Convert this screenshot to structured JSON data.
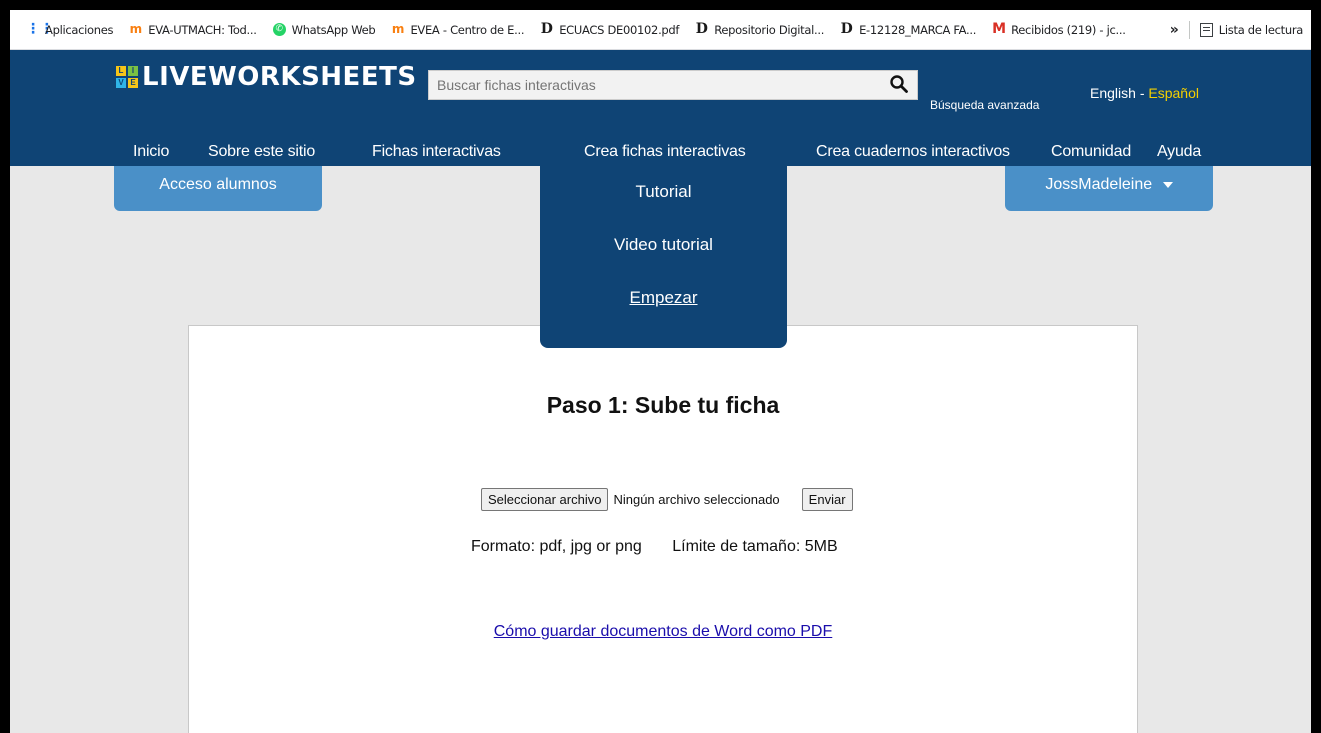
{
  "bookmarks": [
    {
      "icon": "apps-grid-icon",
      "label": "Aplicaciones"
    },
    {
      "icon": "moodle-icon",
      "label": "EVA-UTMACH: Tod..."
    },
    {
      "icon": "whatsapp-icon",
      "label": "WhatsApp Web"
    },
    {
      "icon": "moodle-icon",
      "label": "EVEA - Centro de E..."
    },
    {
      "icon": "document-d-icon",
      "label": "ECUACS DE00102.pdf"
    },
    {
      "icon": "document-d-icon",
      "label": "Repositorio Digital..."
    },
    {
      "icon": "document-d-icon",
      "label": "E-12128_MARCA FA..."
    },
    {
      "icon": "gmail-icon",
      "label": "Recibidos (219) - jc..."
    }
  ],
  "bookmarks_overflow": "»",
  "reading_list": "Lista de lectura",
  "site": {
    "logo_text": "LIVEWORKSHEETS",
    "logo_letters": [
      "L",
      "I",
      "V",
      "E"
    ],
    "search_placeholder": "Buscar fichas interactivas",
    "advanced_search": "Búsqueda avanzada",
    "lang_english": "English",
    "lang_sep": "-",
    "lang_spanish": "Español"
  },
  "nav": [
    "Inicio",
    "Sobre este sitio",
    "Fichas interactivas",
    "Crea fichas interactivas",
    "Crea cuadernos interactivos",
    "Comunidad",
    "Ayuda"
  ],
  "student_access": "Acceso alumnos",
  "user_menu": "JossMadeleine",
  "dropdown": [
    "Tutorial",
    "Video tutorial",
    "Empezar"
  ],
  "main": {
    "title": "Paso 1: Sube tu ficha",
    "select_file_button": "Seleccionar archivo",
    "no_file_text": "Ningún archivo seleccionado",
    "submit_button": "Enviar",
    "format_text": "Formato: pdf, jpg or png",
    "size_limit_text": "Límite de tamaño: 5MB",
    "howto_link": "Cómo guardar documentos de Word como PDF"
  },
  "colors": {
    "header_bg": "#0f4475",
    "tab_bg": "#4a90c8",
    "spanish_accent": "#f5d000",
    "link": "#1a0dab"
  }
}
